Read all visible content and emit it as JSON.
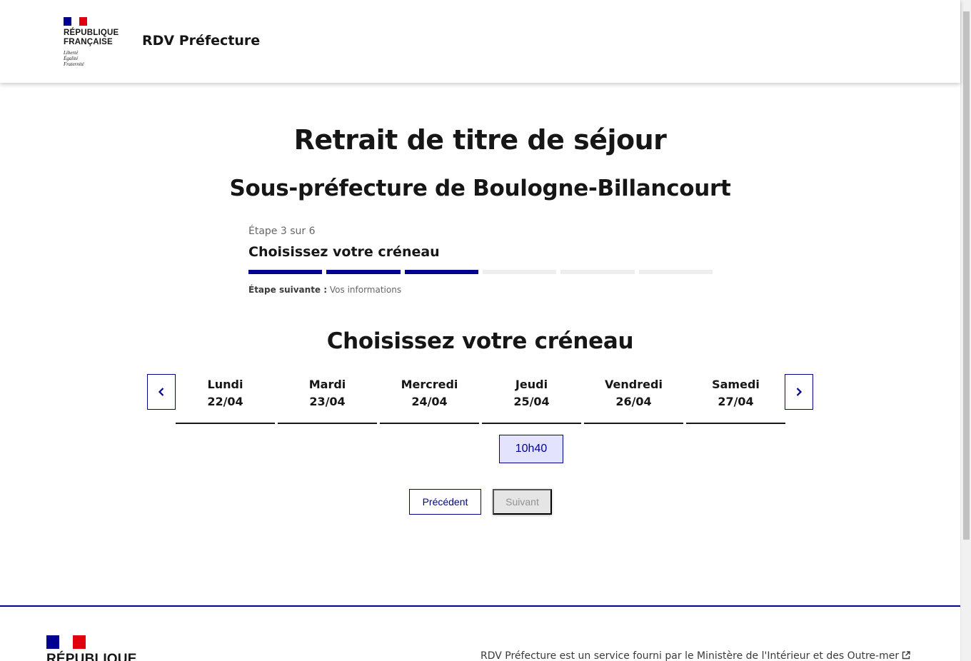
{
  "header": {
    "logo_line1": "République",
    "logo_line2": "Française",
    "motto_1": "Liberté",
    "motto_2": "Égalité",
    "motto_3": "Fraternité",
    "service_title": "RDV Préfecture"
  },
  "main": {
    "title": "Retrait de titre de séjour",
    "subtitle": "Sous-préfecture de Boulogne-Billancourt",
    "stepper": {
      "state": "Étape 3 sur 6",
      "title": "Choisissez votre créneau",
      "total_steps": 6,
      "current_step": 3,
      "next_label": "Étape suivante :",
      "next_value": "Vos informations"
    },
    "section_title": "Choisissez votre créneau",
    "days": [
      {
        "name": "Lundi",
        "date": "22/04"
      },
      {
        "name": "Mardi",
        "date": "23/04"
      },
      {
        "name": "Mercredi",
        "date": "24/04"
      },
      {
        "name": "Jeudi",
        "date": "25/04"
      },
      {
        "name": "Vendredi",
        "date": "26/04"
      },
      {
        "name": "Samedi",
        "date": "27/04"
      }
    ],
    "slot": "10h40",
    "buttons": {
      "previous": "Précédent",
      "next": "Suivant"
    }
  },
  "footer": {
    "logo_line1": "République",
    "description": "RDV Préfecture est un service fourni par le Ministère de l'Intérieur et des Outre-mer"
  },
  "colors": {
    "primary": "#000091",
    "slot_bg": "#e3e3fd",
    "disabled_bg": "#e5e5e5",
    "marianne_red": "#e1000f"
  },
  "icons": {
    "prev": "chevron-left-icon",
    "next": "chevron-right-icon",
    "external": "external-link-icon"
  }
}
